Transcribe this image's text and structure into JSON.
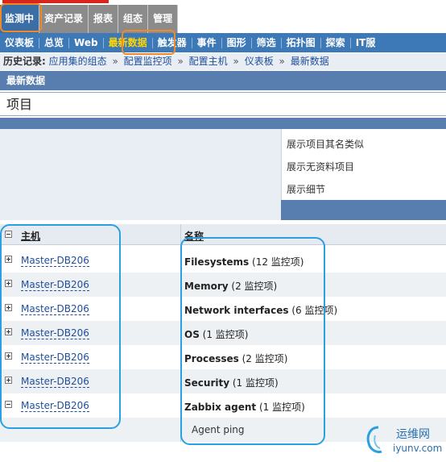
{
  "nav": {
    "main_tabs": [
      {
        "label": "监测中",
        "active": true
      },
      {
        "label": "资产记录",
        "active": false
      },
      {
        "label": "报表",
        "active": false
      },
      {
        "label": "组态",
        "active": false
      },
      {
        "label": "管理",
        "active": false
      }
    ],
    "sub_items": [
      {
        "label": "仪表板",
        "active": false
      },
      {
        "label": "总览",
        "active": false
      },
      {
        "label": "Web",
        "active": false
      },
      {
        "label": "最新数据",
        "active": true
      },
      {
        "label": "触发器",
        "active": false
      },
      {
        "label": "事件",
        "active": false
      },
      {
        "label": "图形",
        "active": false
      },
      {
        "label": "筛选",
        "active": false
      },
      {
        "label": "拓扑图",
        "active": false
      },
      {
        "label": "探索",
        "active": false
      },
      {
        "label": "IT服",
        "active": false
      }
    ]
  },
  "breadcrumb": {
    "label": "历史记录:",
    "items": [
      "应用集的组态",
      "配置监控项",
      "配置主机",
      "仪表板",
      "最新数据"
    ]
  },
  "section": {
    "header": "最新数据",
    "item_title": "项目"
  },
  "filter": {
    "options": [
      "展示项目其名类似",
      "展示无资料项目",
      "展示细节"
    ]
  },
  "table": {
    "header_host": "主机",
    "header_name": "名称",
    "rows": [
      {
        "host": "Master-DB206",
        "name": "Filesystems",
        "count": "(12 监控项)"
      },
      {
        "host": "Master-DB206",
        "name": "Memory",
        "count": "(2 监控项)"
      },
      {
        "host": "Master-DB206",
        "name": "Network interfaces",
        "count": "(6 监控项)"
      },
      {
        "host": "Master-DB206",
        "name": "OS",
        "count": "(1 监控项)"
      },
      {
        "host": "Master-DB206",
        "name": "Processes",
        "count": "(2 监控项)"
      },
      {
        "host": "Master-DB206",
        "name": "Security",
        "count": "(1 监控项)"
      },
      {
        "host": "Master-DB206",
        "name": "Zabbix agent",
        "count": "(1 监控项)"
      }
    ],
    "sub_item": "Agent ping"
  },
  "watermark": {
    "brand": "运维网",
    "url": "iyunv.com"
  }
}
